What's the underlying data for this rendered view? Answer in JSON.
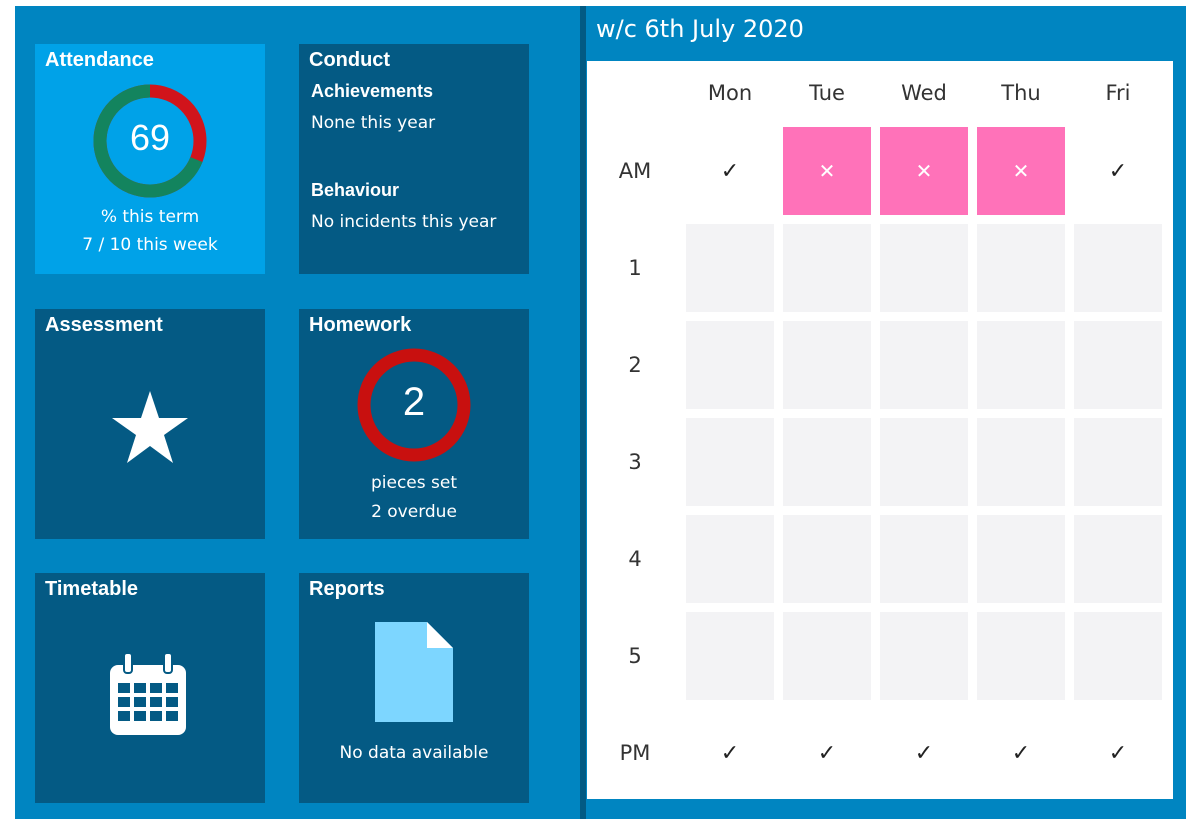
{
  "attendance": {
    "title": "Attendance",
    "percent": "69",
    "percent_value": 69,
    "caption": "% this term",
    "week": "7 / 10 this week",
    "colors": {
      "present": "#13845e",
      "absent": "#d1141b"
    }
  },
  "conduct": {
    "title": "Conduct",
    "achievements_label": "Achievements",
    "achievements_text": "None this year",
    "behaviour_label": "Behaviour",
    "behaviour_text": "No incidents this year"
  },
  "assessment": {
    "title": "Assessment",
    "icon": "star-icon"
  },
  "homework": {
    "title": "Homework",
    "count": "2",
    "caption": "pieces set",
    "overdue": "2 overdue",
    "ring_color": "#c8100f"
  },
  "timetable_tile": {
    "title": "Timetable",
    "icon": "calendar-icon"
  },
  "reports": {
    "title": "Reports",
    "icon": "document-icon",
    "message": "No data available"
  },
  "week": {
    "title": "w/c 6th July 2020",
    "days": [
      "Mon",
      "Tue",
      "Wed",
      "Thu",
      "Fri"
    ],
    "rows": [
      "AM",
      "1",
      "2",
      "3",
      "4",
      "5",
      "PM"
    ],
    "am": [
      "✓",
      "✕",
      "✕",
      "✕",
      "✓"
    ],
    "pm": [
      "✓",
      "✓",
      "✓",
      "✓",
      "✓"
    ],
    "absent_color": "#ff72b9"
  }
}
